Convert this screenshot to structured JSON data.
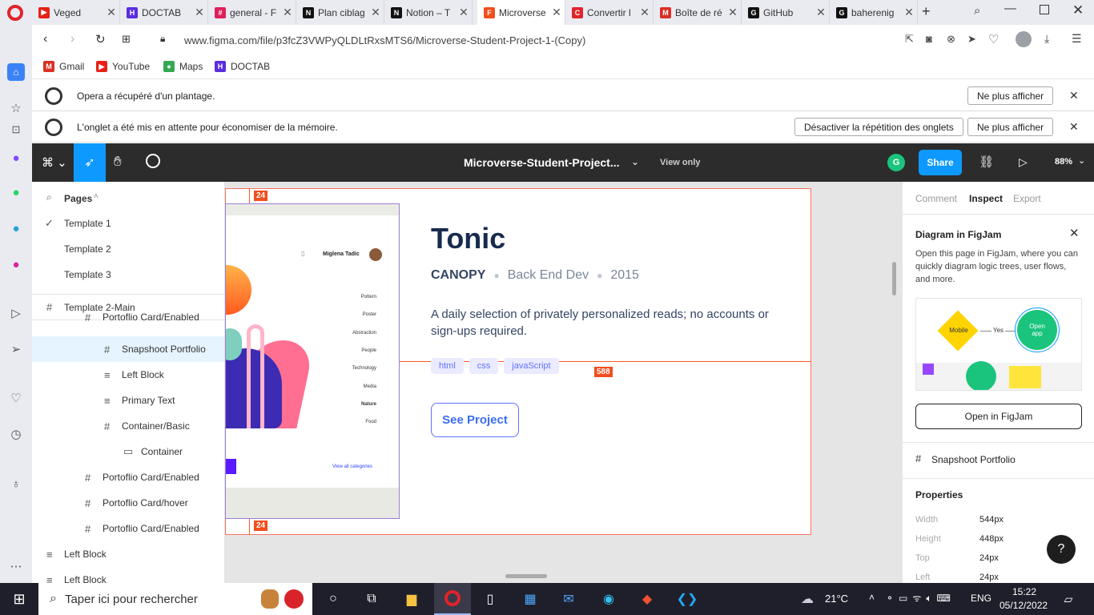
{
  "tabs": [
    {
      "title": "Veged",
      "color": "#e62117",
      "glyph": "▶"
    },
    {
      "title": "DOCTAB",
      "color": "#5b2de0",
      "glyph": "H"
    },
    {
      "title": "general - F",
      "color": "#e01e5a",
      "glyph": "#"
    },
    {
      "title": "Plan ciblag",
      "color": "#111111",
      "glyph": "N"
    },
    {
      "title": "Notion – T",
      "color": "#111111",
      "glyph": "N"
    },
    {
      "title": "Microverse",
      "color": "#f24e1e",
      "glyph": "F"
    },
    {
      "title": "Convertir l",
      "color": "#e0242b",
      "glyph": "C"
    },
    {
      "title": "Boîte de ré",
      "color": "#d93025",
      "glyph": "M"
    },
    {
      "title": "GitHub",
      "color": "#111111",
      "glyph": "G"
    },
    {
      "title": "baherenig",
      "color": "#111111",
      "glyph": "G"
    }
  ],
  "address": {
    "url": "www.figma.com/file/p3fcZ3VWPyQLDLtRxsMTS6/Microverse-Student-Project-1-(Copy)"
  },
  "bookmarks": [
    {
      "label": "Gmail",
      "color": "#d93025",
      "glyph": "M"
    },
    {
      "label": "YouTube",
      "color": "#e62117",
      "glyph": "▶"
    },
    {
      "label": "Maps",
      "color": "#34a853",
      "glyph": "●"
    },
    {
      "label": "DOCTAB",
      "color": "#5b2de0",
      "glyph": "H"
    }
  ],
  "infobars": {
    "crash_message": "Opera a récupéré d'un plantage.",
    "crash_button": "Ne plus afficher",
    "snooze_message": "L'onglet a été mis en attente pour économiser de la mémoire.",
    "snooze_disable_button": "Désactiver la répétition des onglets",
    "snooze_button": "Ne plus afficher"
  },
  "figma_toolbar": {
    "file_title": "Microverse-Student-Project...",
    "view_mode": "View only",
    "avatar_letter": "G",
    "share_label": "Share",
    "zoom": "88%"
  },
  "layers_panel": {
    "pages_label": "Pages",
    "pages": [
      "Template 1",
      "Template 2",
      "Template 3"
    ],
    "selected_page": "Template 1",
    "layers": [
      {
        "label": "Template 2-Main",
        "icon": "#",
        "indent": 0
      },
      {
        "label": "Portoflio Card/Enabled",
        "icon": "#",
        "indent": 1
      },
      {
        "label": "Snapshoot Portfolio",
        "icon": "#",
        "indent": 2
      },
      {
        "label": "Left Block",
        "icon": "≡",
        "indent": 2
      },
      {
        "label": "Primary Text",
        "icon": "≡",
        "indent": 2
      },
      {
        "label": "Container/Basic",
        "icon": "#",
        "indent": 2
      },
      {
        "label": "Container",
        "icon": "▭",
        "indent": 3
      },
      {
        "label": "Portoflio Card/Enabled",
        "icon": "#",
        "indent": 1
      },
      {
        "label": "Portoflio Card/hover",
        "icon": "#",
        "indent": 1
      },
      {
        "label": "Portoflio Card/Enabled",
        "icon": "#",
        "indent": 1
      },
      {
        "label": "Left Block",
        "icon": "≡",
        "indent": 0
      },
      {
        "label": "Left Block",
        "icon": "≡",
        "indent": 0
      }
    ]
  },
  "canvas": {
    "spacing_top": "24",
    "spacing_bottom": "24",
    "spacing_right": "588",
    "snapshot": {
      "user_name": "Miglena Tadic",
      "menu": [
        "Pottern",
        "Poster",
        "Abstraction",
        "People",
        "Technology",
        "Media",
        "Nature",
        "Food"
      ],
      "view_all": "View all categories"
    },
    "card": {
      "title": "Tonic",
      "client": "CANOPY",
      "role": "Back End Dev",
      "year": "2015",
      "description": "A daily selection of privately personalized reads; no accounts or sign-ups required.",
      "tags": [
        "html",
        "css",
        "javaScript"
      ],
      "button": "See Project"
    }
  },
  "right_panel": {
    "tabs": [
      "Comment",
      "Inspect",
      "Export"
    ],
    "active_tab": "Inspect",
    "figjam_title": "Diagram in FigJam",
    "figjam_text": "Open this page in FigJam, where you can quickly diagram logic trees, user flows, and more.",
    "figjam_preview": {
      "node1": "Mobile",
      "edge": "Yes",
      "node2": "Open app"
    },
    "figjam_button": "Open in FigJam",
    "selection_name": "Snapshoot Portfolio",
    "properties_label": "Properties",
    "properties": [
      {
        "key": "Width",
        "value": "544px"
      },
      {
        "key": "Height",
        "value": "448px"
      },
      {
        "key": "Top",
        "value": "24px"
      },
      {
        "key": "Left",
        "value": "24px"
      }
    ],
    "help": "?"
  },
  "taskbar": {
    "search_placeholder": "Taper ici pour rechercher",
    "weather": "21°C",
    "lang": "ENG",
    "time": "15:22",
    "date": "05/12/2022"
  }
}
